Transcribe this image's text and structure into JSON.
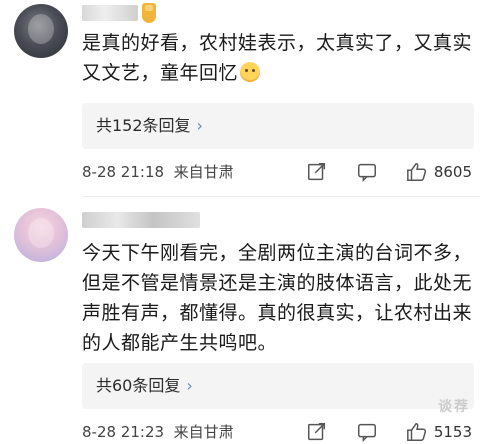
{
  "comments": [
    {
      "content": "是真的好看，农村娃表示，太真实了，又真实又文艺，童年回忆",
      "replies_label": "共152条回复",
      "time": "8-28 21:18",
      "location": "来自甘肃",
      "likes": "8605"
    },
    {
      "content": "今天下午刚看完，全剧两位主演的台词不多，但是不管是情景还是主演的肢体语言，此处无声胜有声，都懂得。真的很真实，让农村出来的人都能产生共鸣吧。",
      "replies_label": "共60条回复",
      "time": "8-28 21:23",
      "location": "来自甘肃",
      "likes": "5153"
    }
  ],
  "watermark": "谈荐",
  "icons": {
    "share": "share-icon",
    "comment": "comment-icon",
    "like": "like-icon",
    "chevron": "chevron-right-icon",
    "emoji": "emoji-icon"
  },
  "colors": {
    "reply_box": "#f4f4f4",
    "chevron": "#6b8bb5",
    "badge": "#f0b53a"
  }
}
